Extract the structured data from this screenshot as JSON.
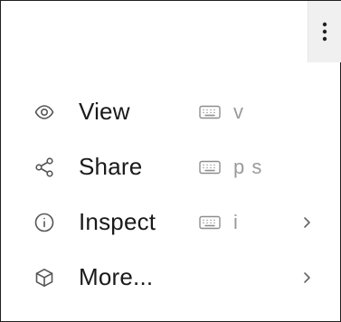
{
  "toolbar": {
    "more_button_icon": "vertical-ellipsis-icon"
  },
  "menu": {
    "items": [
      {
        "label": "View",
        "icon": "eye-icon",
        "shortcut_icon": "keyboard-icon",
        "shortcut": "v",
        "has_submenu": false
      },
      {
        "label": "Share",
        "icon": "share-icon",
        "shortcut_icon": "keyboard-icon",
        "shortcut": "p s",
        "has_submenu": false
      },
      {
        "label": "Inspect",
        "icon": "info-icon",
        "shortcut_icon": "keyboard-icon",
        "shortcut": "i",
        "has_submenu": true
      },
      {
        "label": "More...",
        "icon": "cube-icon",
        "has_submenu": true
      }
    ]
  },
  "colors": {
    "text": "#1a1a1a",
    "muted": "#9a9a9a",
    "icon": "#555555",
    "button_bg": "#f0f0f0",
    "border": "#1f1f1f"
  }
}
